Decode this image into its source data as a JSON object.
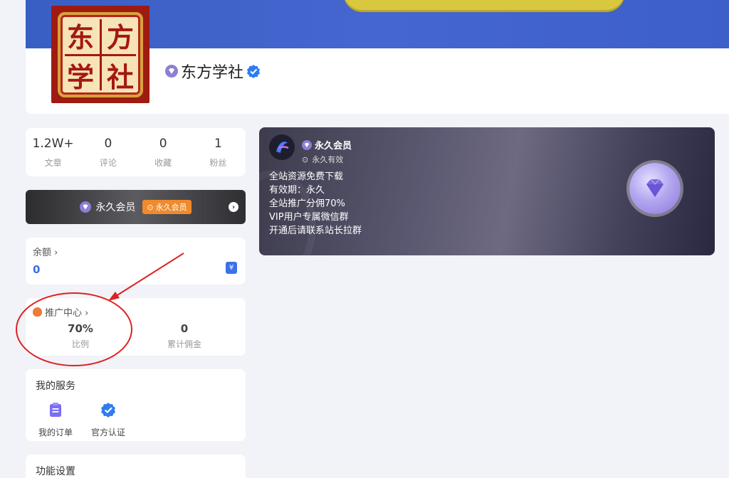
{
  "profile": {
    "logo_chars": [
      "东",
      "方",
      "学",
      "社"
    ],
    "name": "东方学社"
  },
  "stats": [
    {
      "value": "1.2W+",
      "label": "文章"
    },
    {
      "value": "0",
      "label": "评论"
    },
    {
      "value": "0",
      "label": "收藏"
    },
    {
      "value": "1",
      "label": "粉丝"
    }
  ],
  "vip_bar": {
    "label": "永久会员",
    "badge": "永久会员"
  },
  "balance": {
    "title": "余额 ›",
    "value": "0",
    "wallet_symbol": "¥"
  },
  "promotion": {
    "title": "推广中心 ›",
    "ratio_value": "70%",
    "ratio_label": "比例",
    "commission_value": "0",
    "commission_label": "累计佣金"
  },
  "services": {
    "title": "我的服务",
    "items": [
      {
        "label": "我的订单",
        "icon": "clipboard-icon"
      },
      {
        "label": "官方认证",
        "icon": "verified-badge-icon"
      }
    ]
  },
  "functions": {
    "title": "功能设置"
  },
  "vip_card": {
    "title": "永久会员",
    "validity": "永久有效",
    "benefits": [
      "全站资源免费下载",
      "有效期：永久",
      "全站推广分佣70%",
      "VIP用户专属微信群",
      "开通后请联系站长拉群"
    ]
  },
  "colors": {
    "banner": "#3f63cb",
    "accent_blue": "#3b6fe0",
    "badge_orange": "#f08a2c",
    "annotation_red": "#e02020"
  }
}
